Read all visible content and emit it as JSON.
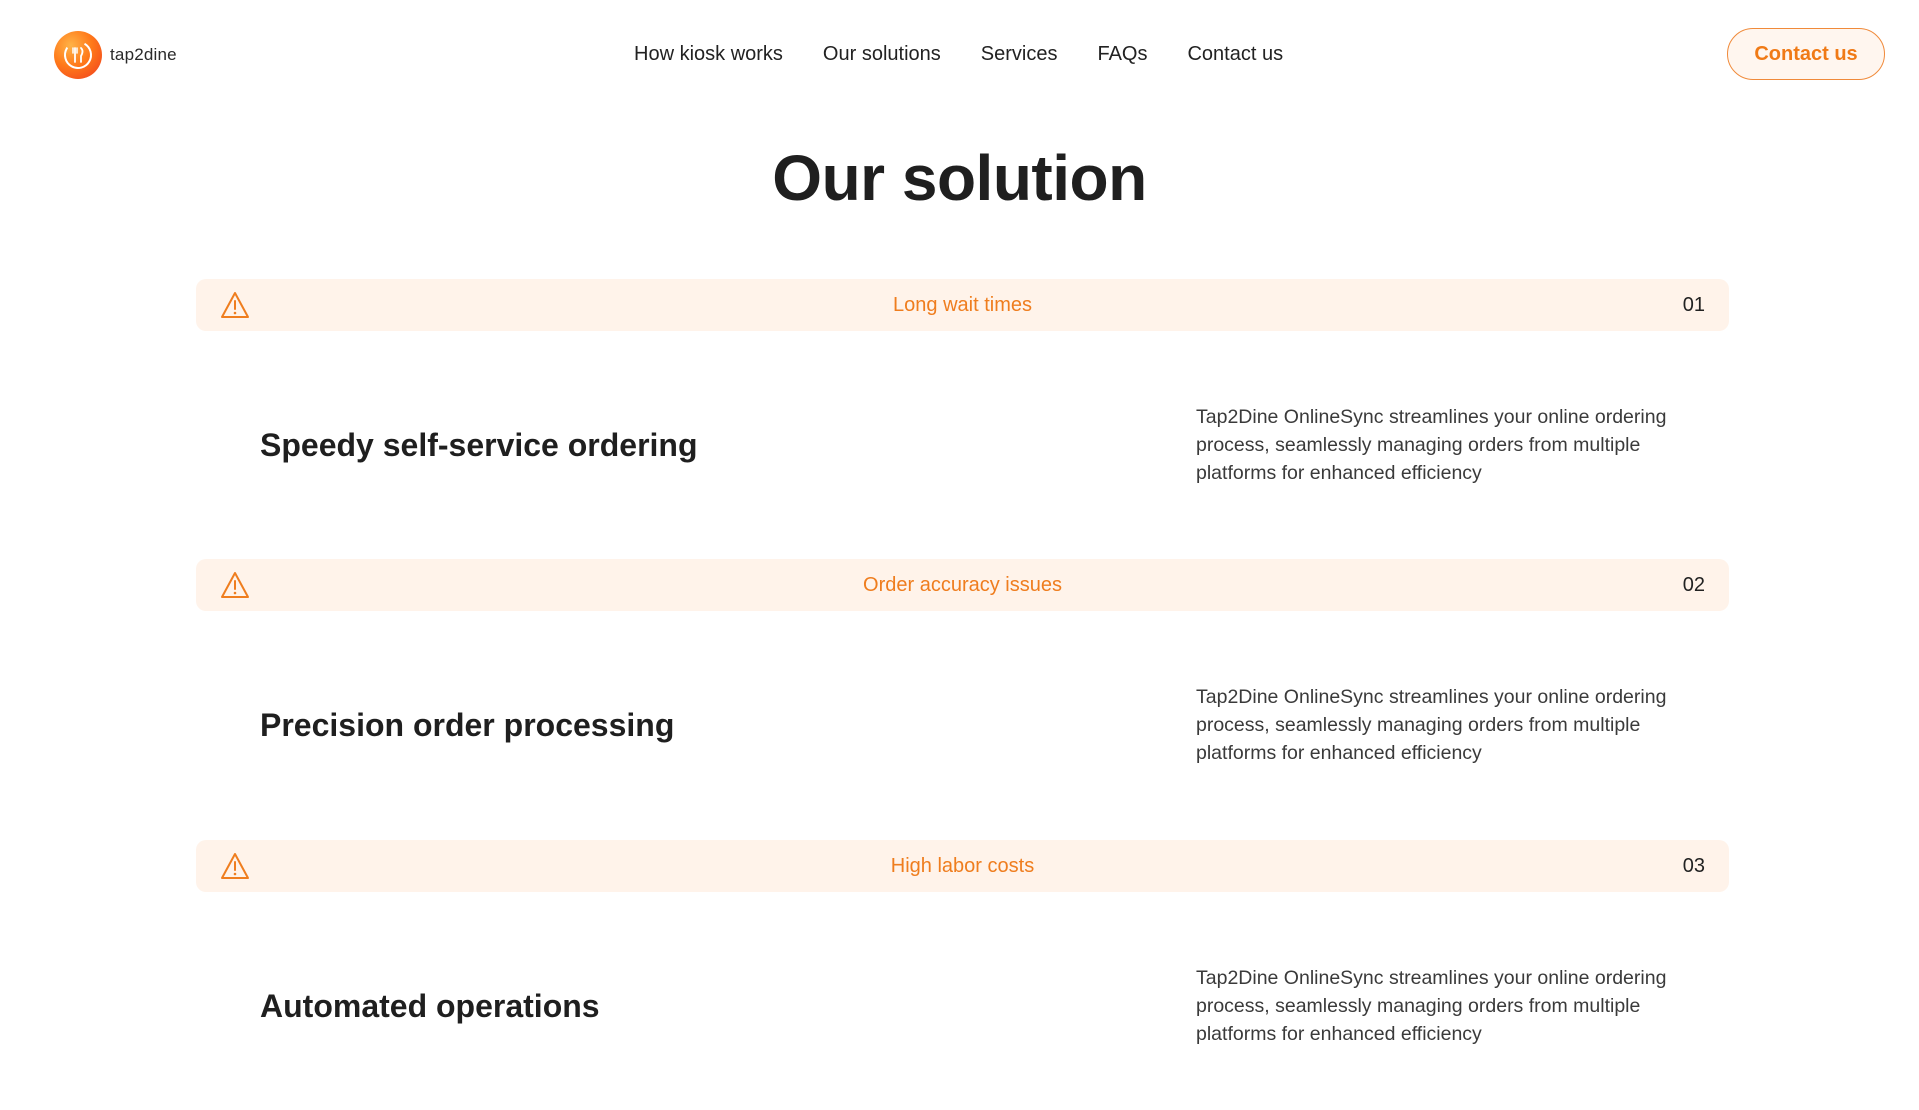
{
  "header": {
    "logo_text": "tap2dine",
    "nav": [
      {
        "label": "How kiosk works"
      },
      {
        "label": "Our solutions"
      },
      {
        "label": "Services"
      },
      {
        "label": "FAQs"
      },
      {
        "label": "Contact us"
      }
    ],
    "cta_label": "Contact us"
  },
  "section": {
    "title": "Our solution",
    "items": [
      {
        "problem": "Long wait times",
        "number": "01",
        "solution": "Speedy self-service ordering",
        "description": "Tap2Dine OnlineSync streamlines your online ordering process, seamlessly managing orders from multiple platforms for enhanced efficiency"
      },
      {
        "problem": "Order accuracy issues",
        "number": "02",
        "solution": "Precision order processing",
        "description": "Tap2Dine OnlineSync streamlines your online ordering process, seamlessly managing orders from multiple platforms for enhanced efficiency"
      },
      {
        "problem": "High labor costs",
        "number": "03",
        "solution": "Automated operations",
        "description": "Tap2Dine OnlineSync streamlines your online ordering process, seamlessly managing orders from multiple platforms for enhanced efficiency"
      }
    ]
  },
  "colors": {
    "accent": "#ef7d1e",
    "bar_background": "#fff3ea"
  },
  "icons": {
    "logo": "fork-knife-icon",
    "problem": "warning-triangle-icon"
  }
}
